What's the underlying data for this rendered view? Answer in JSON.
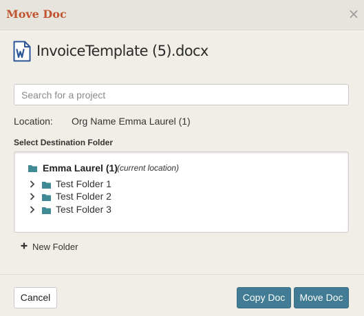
{
  "colors": {
    "title": "#c0552f",
    "folder": "#3f8a94",
    "primary_button": "#417b94",
    "word_icon": "#2a5699",
    "modal_background": "#f0eee6"
  },
  "header": {
    "title": "Move Doc",
    "close_symbol": "×"
  },
  "document": {
    "icon": "word-document-icon",
    "name": "InvoiceTemplate (5).docx"
  },
  "search": {
    "placeholder": "Search for a project",
    "value": ""
  },
  "location": {
    "label": "Location:",
    "value": "Org Name Emma Laurel (1)"
  },
  "destination": {
    "label": "Select Destination Folder",
    "root": {
      "name": "Emma Laurel (1)",
      "note": "(current location)"
    },
    "folders": [
      {
        "name": "Test Folder 1"
      },
      {
        "name": "Test Folder 2"
      },
      {
        "name": "Test Folder 3"
      }
    ]
  },
  "new_folder": {
    "label": "New Folder"
  },
  "footer": {
    "cancel_label": "Cancel",
    "copy_label": "Copy Doc",
    "move_label": "Move Doc"
  }
}
